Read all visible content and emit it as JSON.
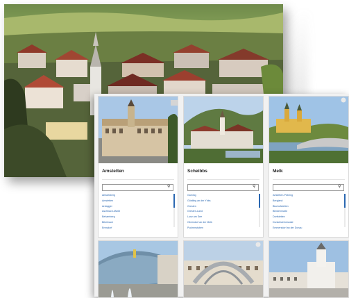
{
  "cards": [
    {
      "title": "Amstetten",
      "places": [
        "Allhartsberg",
        "Amstetten",
        "Ardagger",
        "Aschbach-Markt",
        "Behamberg",
        "Biberbach",
        "Ennsdorf"
      ]
    },
    {
      "title": "Scheibbs",
      "places": [
        "Gaming",
        "Göstling an der Ybbs",
        "Gresten",
        "Gresten-Land",
        "Lunz am See",
        "Oberndorf an der Melk",
        "Puchenstuben"
      ]
    },
    {
      "title": "Melk",
      "places": [
        "Artstetten-Pöbring",
        "Bergland",
        "Bischofstetten",
        "Blindenmarkt",
        "Dorfstetten",
        "Dunkelsteinerwald",
        "Emmersdorf an der Donau"
      ]
    }
  ],
  "icons": {
    "search": "search-icon",
    "corner": "info-icon"
  },
  "colors": {
    "link": "#2a67b1",
    "panel": "#f1f1f1"
  }
}
